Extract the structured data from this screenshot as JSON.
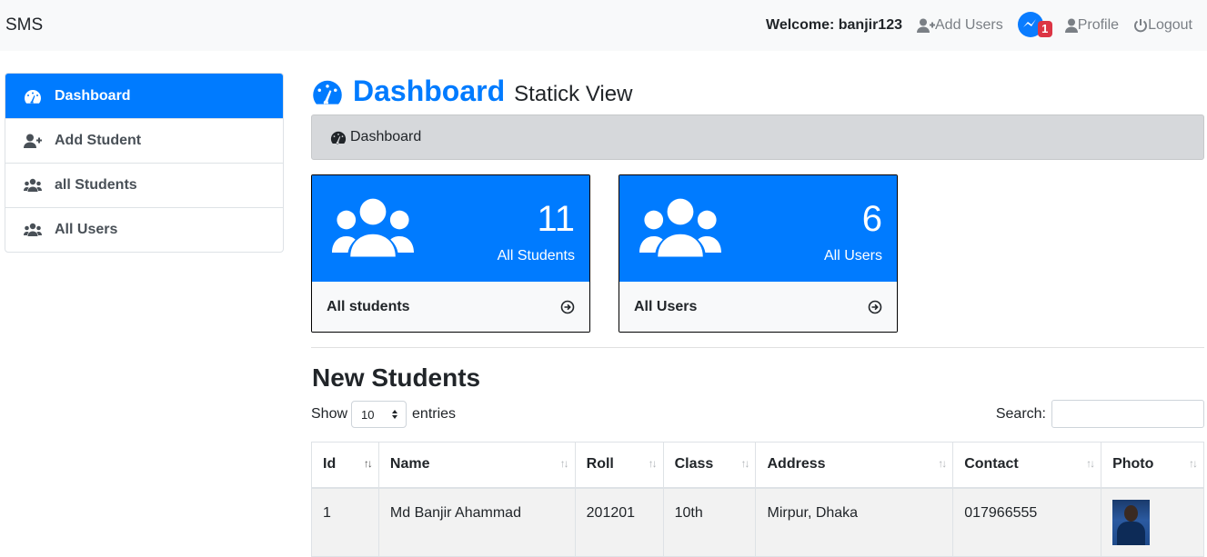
{
  "navbar": {
    "brand": "SMS",
    "welcome": "Welcome: banjir123",
    "add_users": "Add Users",
    "messenger_badge": "1",
    "profile": "Profile",
    "logout": "Logout"
  },
  "sidebar": {
    "items": [
      {
        "label": "Dashboard",
        "icon": "tachometer-icon",
        "active": true
      },
      {
        "label": "Add Student",
        "icon": "user-plus-icon"
      },
      {
        "label": "all Students",
        "icon": "users-icon"
      },
      {
        "label": "All Users",
        "icon": "users-icon"
      }
    ]
  },
  "header": {
    "title": "Dashboard",
    "subtitle": "Statick View"
  },
  "breadcrumb": {
    "label": "Dashboard"
  },
  "cards": [
    {
      "count": "11",
      "caption": "All Students",
      "footer": "All students"
    },
    {
      "count": "6",
      "caption": "All Users",
      "footer": "All Users"
    }
  ],
  "section": {
    "title": "New Students"
  },
  "table_controls": {
    "show_label": "Show",
    "entries_value": "10",
    "entries_label": "entries",
    "search_label": "Search:"
  },
  "table": {
    "columns": [
      "Id",
      "Name",
      "Roll",
      "Class",
      "Address",
      "Contact",
      "Photo"
    ],
    "rows": [
      {
        "id": "1",
        "name": "Md Banjir Ahammad",
        "roll": "201201",
        "class": "10th",
        "address": "Mirpur, Dhaka",
        "contact": "017966555"
      }
    ]
  },
  "colors": {
    "primary": "#007bff",
    "badge": "#dc3545",
    "navbar_bg": "#f8f9fa"
  }
}
